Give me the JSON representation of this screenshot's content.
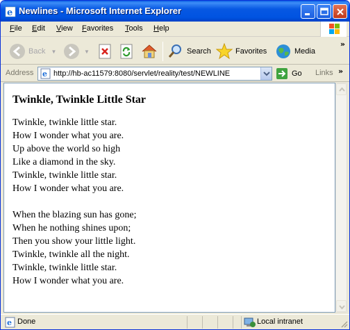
{
  "window": {
    "title": "Newlines - Microsoft Internet Explorer"
  },
  "menu": {
    "items": [
      "File",
      "Edit",
      "View",
      "Favorites",
      "Tools",
      "Help"
    ]
  },
  "toolbar": {
    "back_label": "Back",
    "search_label": "Search",
    "favorites_label": "Favorites",
    "media_label": "Media",
    "more_chevron": "»"
  },
  "address": {
    "label": "Address",
    "url": "http://hb-ac11579:8080/servlet/reality/test/NEWLINE",
    "go_label": "Go",
    "links_label": "Links",
    "links_chevron": "»"
  },
  "page": {
    "heading": "Twinkle, Twinkle Little Star",
    "stanzas": [
      [
        "Twinkle, twinkle little star.",
        "How I wonder what you are.",
        "Up above the world so high",
        "Like a diamond in the sky.",
        "Twinkle, twinkle little star.",
        "How I wonder what you are."
      ],
      [
        "When the blazing sun has gone;",
        "When he nothing shines upon;",
        "Then you show your little light.",
        "Twinkle, twinkle all the night.",
        "Twinkle, twinkle little star.",
        "How I wonder what you are."
      ]
    ]
  },
  "status": {
    "text": "Done",
    "zone": "Local intranet"
  },
  "colors": {
    "titlebar": "#0054e3",
    "chrome": "#ece9d8",
    "address_border": "#7f9db9"
  }
}
